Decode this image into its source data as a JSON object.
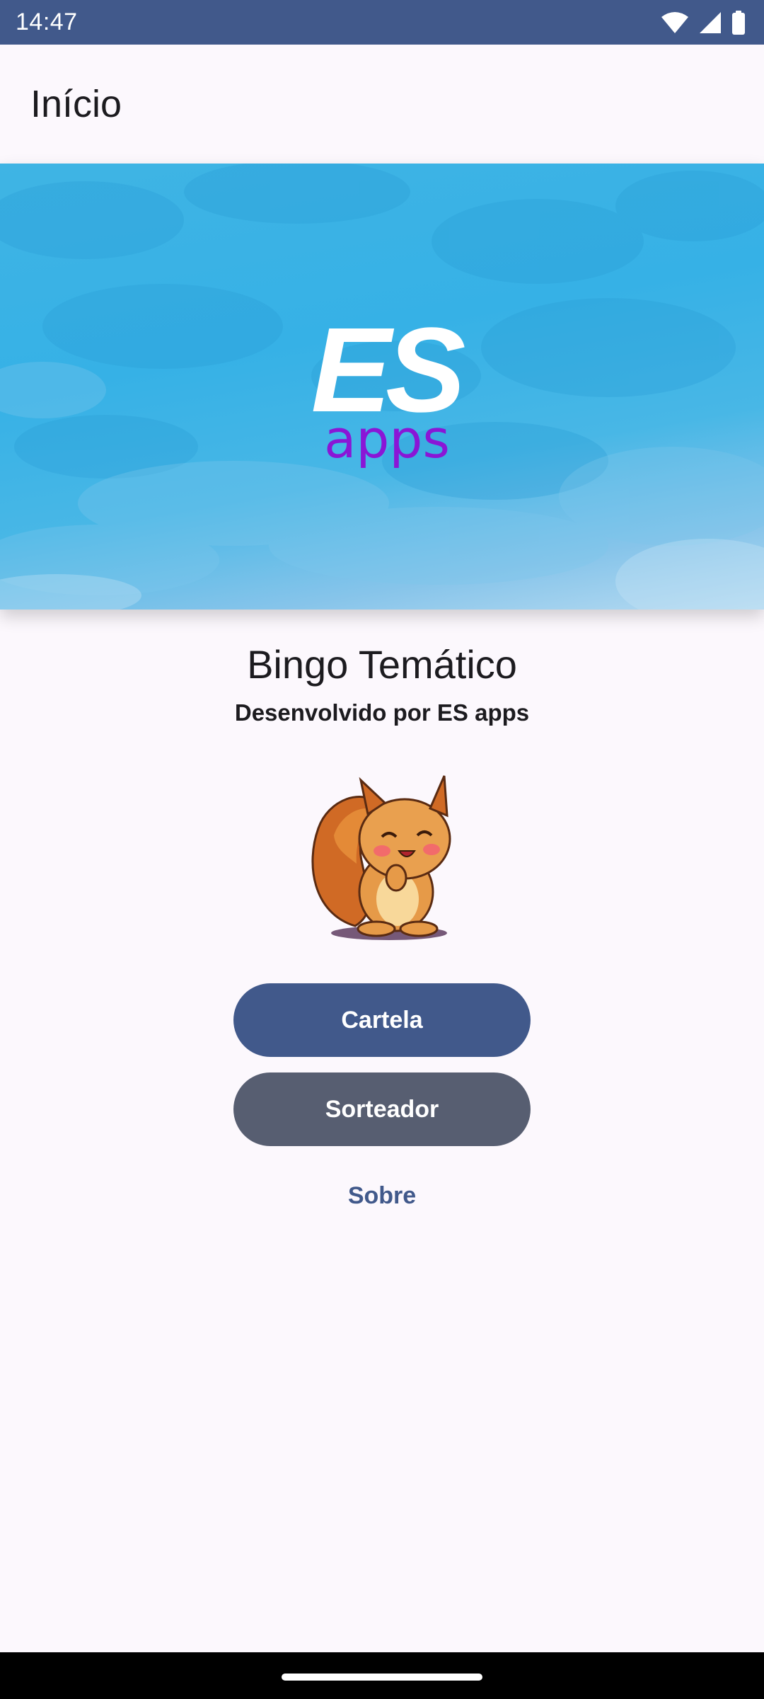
{
  "status_bar": {
    "time": "14:47",
    "icons": [
      "wifi-icon",
      "signal-icon",
      "battery-icon"
    ]
  },
  "top_bar": {
    "title": "Início"
  },
  "banner": {
    "logo_main": "ES",
    "logo_sub": "apps"
  },
  "main": {
    "title": "Bingo Temático",
    "subtitle": "Desenvolvido por ES apps",
    "mascot": "squirrel-mascot",
    "primary_button": "Cartela",
    "secondary_button": "Sorteador",
    "link": "Sobre"
  },
  "colors": {
    "primary": "#41598b",
    "secondary": "#575e71",
    "background": "#fcf8fd",
    "banner_blue": "#36b1e6",
    "logo_purple": "#8a16d6"
  }
}
